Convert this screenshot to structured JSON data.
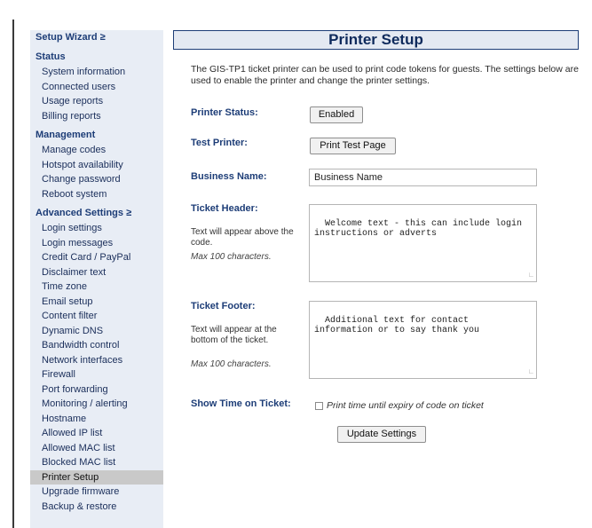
{
  "sidebar": {
    "setup_wizard": "Setup Wizard ≥",
    "status": {
      "heading": "Status",
      "items": [
        "System information",
        "Connected users",
        "Usage reports",
        "Billing reports"
      ]
    },
    "management": {
      "heading": "Management",
      "items": [
        "Manage codes",
        "Hotspot availability",
        "Change password",
        "Reboot system"
      ]
    },
    "advanced": {
      "heading": "Advanced Settings ≥",
      "items": [
        "Login settings",
        "Login messages",
        "Credit Card / PayPal",
        "Disclaimer text",
        "Time zone",
        "Email setup",
        "Content filter",
        "Dynamic DNS",
        "Bandwidth control",
        "Network interfaces",
        "Firewall",
        "Port forwarding",
        "Monitoring / alerting",
        "Hostname",
        "Allowed IP list",
        "Allowed MAC list",
        "Blocked MAC list",
        "Printer Setup",
        "Upgrade firmware",
        "Backup & restore"
      ]
    },
    "active_item": "Printer Setup"
  },
  "page": {
    "title": "Printer Setup",
    "intro": "The GIS-TP1 ticket printer can be used to print code tokens for guests. The settings below are used to enable the printer and change the printer settings."
  },
  "form": {
    "printer_status": {
      "label": "Printer Status:",
      "button": "Enabled"
    },
    "test_printer": {
      "label": "Test Printer:",
      "button": "Print Test Page"
    },
    "business_name": {
      "label": "Business Name:",
      "value": "Business Name"
    },
    "ticket_header": {
      "label": "Ticket Header:",
      "hint": "Text will appear above the code.",
      "max": "Max 100 characters.",
      "value": "Welcome text - this can include login instructions or adverts"
    },
    "ticket_footer": {
      "label": "Ticket Footer:",
      "hint": "Text will appear at the bottom of the ticket.",
      "max": "Max 100 characters.",
      "value": "Additional text for contact information or to say thank you"
    },
    "show_time": {
      "label": "Show Time on Ticket:",
      "checkbox_label": "Print time until expiry of code on ticket",
      "checked": false
    },
    "update_button": "Update Settings"
  }
}
